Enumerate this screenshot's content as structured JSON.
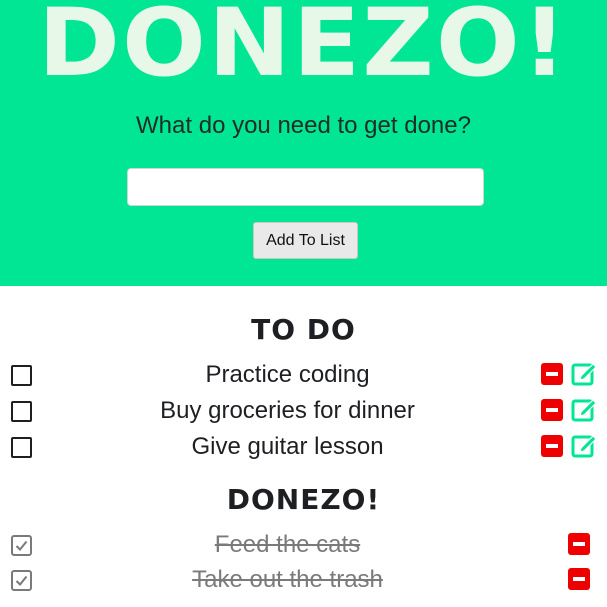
{
  "app": {
    "title": "DONEZO!",
    "prompt": "What do you need to get done?",
    "input_value": "",
    "input_placeholder": "",
    "add_button_label": "Add To List"
  },
  "todo_section": {
    "heading": "TO DO",
    "items": [
      {
        "label": "Practice coding",
        "checked": false
      },
      {
        "label": "Buy groceries for dinner",
        "checked": false
      },
      {
        "label": "Give guitar lesson",
        "checked": false
      }
    ]
  },
  "done_section": {
    "heading": "DONEZO!",
    "items": [
      {
        "label": "Feed the cats",
        "checked": true
      },
      {
        "label": "Take out the trash",
        "checked": true
      }
    ]
  },
  "colors": {
    "hero_background": "#00e695",
    "delete": "#ee0000",
    "edit": "#00e695",
    "done_text": "#7a7a7a"
  }
}
